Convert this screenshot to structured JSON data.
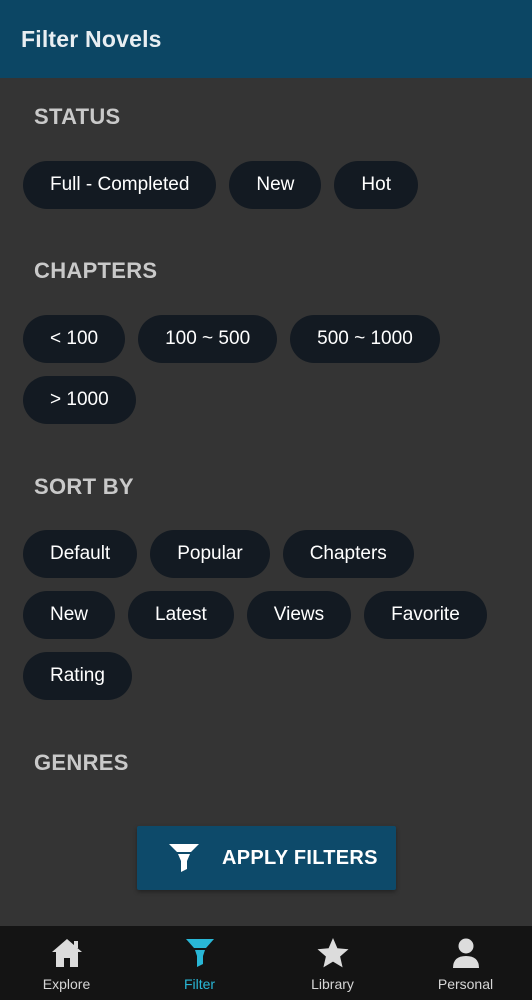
{
  "app_bar": {
    "title": "Filter Novels"
  },
  "sections": {
    "status": {
      "title": "STATUS",
      "chips": [
        "Full - Completed",
        "New",
        "Hot"
      ]
    },
    "chapters": {
      "title": "CHAPTERS",
      "chips": [
        "< 100",
        "100 ~ 500",
        "500 ~ 1000",
        "> 1000"
      ]
    },
    "sort_by": {
      "title": "SORT BY",
      "chips": [
        "Default",
        "Popular",
        "Chapters",
        "New",
        "Latest",
        "Views",
        "Favorite",
        "Rating"
      ]
    },
    "genres": {
      "title": "GENRES"
    }
  },
  "apply_button": {
    "label": "APPLY FILTERS",
    "icon": "funnel-icon"
  },
  "bottom_nav": {
    "items": [
      {
        "label": "Explore",
        "icon": "home-icon"
      },
      {
        "label": "Filter",
        "icon": "funnel-icon",
        "active": true
      },
      {
        "label": "Library",
        "icon": "star-icon"
      },
      {
        "label": "Personal",
        "icon": "person-icon"
      }
    ]
  },
  "colors": {
    "app_bar": "#0c4664",
    "background": "#343434",
    "chip": "#131a22",
    "active_tab": "#29b7d6",
    "apply_button": "#0d4a6a",
    "bottom_nav": "#141414"
  }
}
